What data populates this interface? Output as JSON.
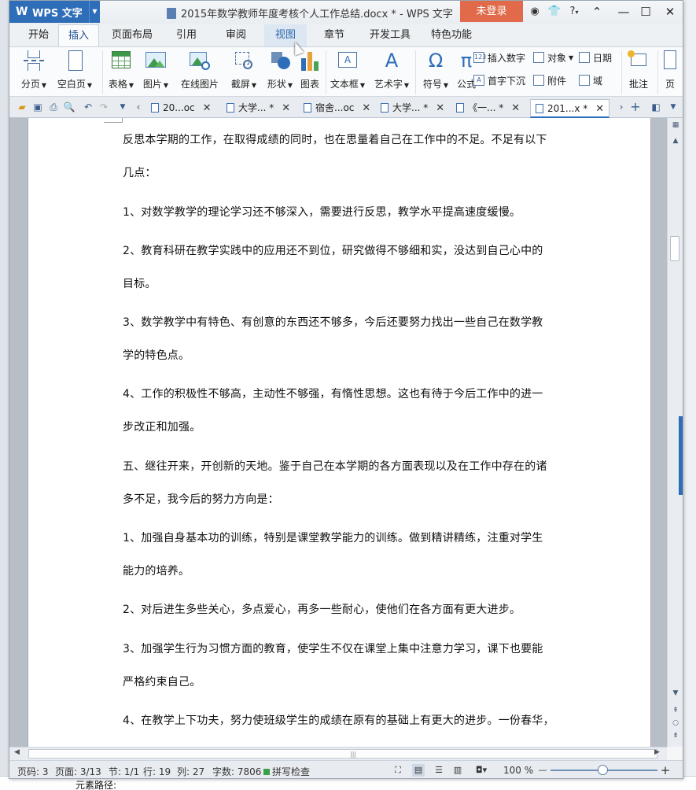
{
  "window": {
    "app_menu_label": "WPS 文字",
    "doc_title": "2015年数学教师年度考核个人工作总结.docx * - WPS 文字",
    "login_label": "未登录",
    "help_label": "?"
  },
  "ribbon_tabs": [
    "开始",
    "插入",
    "页面布局",
    "引用",
    "审阅",
    "视图",
    "章节",
    "开发工具",
    "特色功能"
  ],
  "ribbon_active_tab": "插入",
  "ribbon": {
    "page_break": "分页",
    "blank_page": "空白页",
    "table": "表格",
    "picture": "图片",
    "online_picture": "在线图片",
    "screenshot": "截屏",
    "shape": "形状",
    "chart": "图表",
    "textbox": "文本框",
    "wordart": "艺术字",
    "symbol": "符号",
    "formula": "公式",
    "insert_number": "插入数字",
    "object": "对象",
    "date": "日期",
    "drop_cap": "首字下沉",
    "attachment": "附件",
    "field": "域",
    "comment": "批注",
    "page_label": "页"
  },
  "doc_tabs": [
    {
      "label": "20...oc"
    },
    {
      "label": "大学... *"
    },
    {
      "label": "宿舍...oc"
    },
    {
      "label": "大学... *"
    },
    {
      "label": "《一... *"
    },
    {
      "label": "201...x *"
    }
  ],
  "document": {
    "paragraphs": [
      "反思本学期的工作，在取得成绩的同时，也在思量着自己在工作中的不足。不足有以下",
      "几点：",
      "1、对数学教学的理论学习还不够深入，需要进行反思，教学水平提高速度缓慢。",
      "2、教育科研在教学实践中的应用还不到位，研究做得不够细和实，没达到自己心中的",
      "目标。",
      "3、数学教学中有特色、有创意的东西还不够多，今后还要努力找出一些自己在数学教",
      "学的特色点。",
      "4、工作的积极性不够高，主动性不够强，有惰性思想。这也有待于今后工作中的进一",
      "步改正和加强。",
      "五、继往开来，开创新的天地。鉴于自己在本学期的各方面表现以及在工作中存在的诸",
      "多不足，我今后的努力方向是：",
      "1、加强自身基本功的训练，特别是课堂教学能力的训练。做到精讲精练，注重对学生",
      "能力的培养。",
      "2、对后进生多些关心，多点爱心，再多一些耐心，使他们在各方面有更大进步。",
      "3、加强学生行为习惯方面的教育，使学生不仅在课堂上集中注意力学习，课下也要能",
      "严格约束自己。",
      "4、在教学上下功夫，努力使班级学生的成绩在原有的基础上有更大的进步。一份春华，"
    ]
  },
  "status": {
    "page_code": "页码: 3",
    "page": "页面: 3/13",
    "section": "节: 1/1",
    "row": "行: 19",
    "col": "列: 27",
    "word_count": "字数: 7806",
    "spell_check": "拼写检查",
    "zoom": "100 %"
  },
  "background": {
    "element_path": "元素路径:"
  }
}
